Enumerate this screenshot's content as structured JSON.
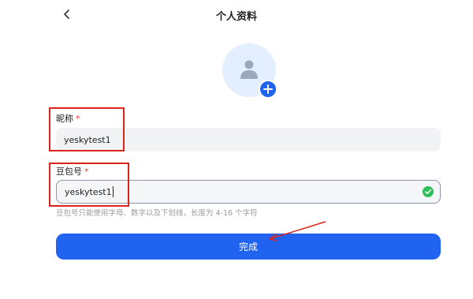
{
  "header": {
    "title": "个人资料",
    "back_icon": "chevron-left-icon"
  },
  "avatar": {
    "icon": "user-icon",
    "add_icon": "plus-icon"
  },
  "form": {
    "nickname": {
      "label": "昵称",
      "required_mark": "*",
      "value": "yeskytest1"
    },
    "doubao_id": {
      "label": "豆包号",
      "required_mark": "*",
      "value": "yeskytest1",
      "status_icon": "check-circle-icon"
    },
    "hint": "豆包号只能使用字母、数字以及下划线，长度为 4-16 个字符"
  },
  "submit": {
    "label": "完成"
  },
  "colors": {
    "primary": "#1f63f0",
    "annotation": "#d9251c",
    "success": "#2fbf5a"
  }
}
